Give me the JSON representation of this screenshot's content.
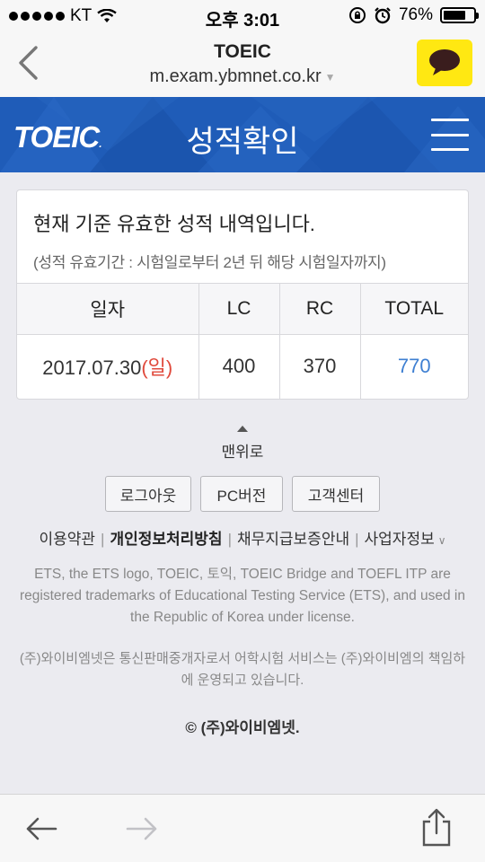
{
  "status_bar": {
    "carrier": "KT",
    "time": "오후 3:01",
    "battery": "76%",
    "battery_level": 0.76
  },
  "browser": {
    "title": "TOEIC",
    "url": "m.exam.ybmnet.co.kr"
  },
  "banner": {
    "logo": "TOEIC",
    "title": "성적확인"
  },
  "score_card": {
    "message": "현재 기준 유효한 성적 내역입니다.",
    "sub_message": "(성적 유효기간 : 시험일로부터 2년 뒤 해당 시험일자까지)",
    "headers": [
      "일자",
      "LC",
      "RC",
      "TOTAL"
    ],
    "row": {
      "date": "2017.07.30",
      "day": "(일)",
      "lc": "400",
      "rc": "370",
      "total": "770"
    }
  },
  "footer": {
    "top_link": "맨위로",
    "buttons": [
      "로그아웃",
      "PC버전",
      "고객센터"
    ],
    "links": [
      "이용약관",
      "개인정보처리방침",
      "채무지급보증안내",
      "사업자정보"
    ],
    "legal": "ETS, the ETS logo, TOEIC, 토익, TOEIC Bridge and TOEFL ITP are registered trademarks of Educational Testing Service (ETS), and used in the Republic of Korea under license.",
    "legal2": "(주)와이비엠넷은 통신판매중개자로서 어학시험 서비스는 (주)와이비엠의 책임하에 운영되고 있습니다.",
    "copyright": "© (주)와이비엠넷."
  },
  "colors": {
    "banner": "#1f5cb8",
    "kakao": "#ffe812",
    "total": "#3e7fd2",
    "day": "#e04a3c"
  }
}
